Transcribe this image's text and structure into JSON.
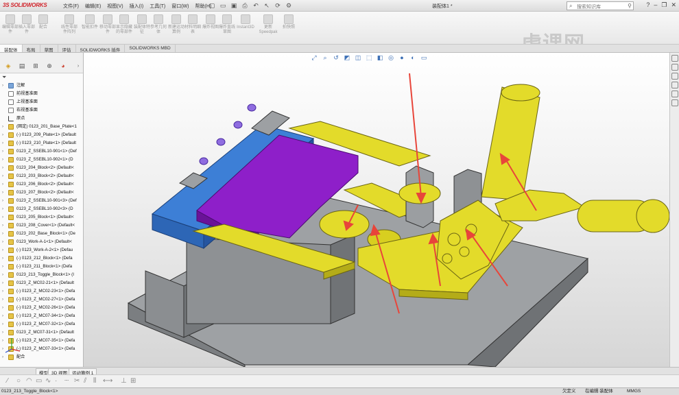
{
  "app": {
    "logo_brand": "SOLIDWORKS",
    "logo_ds": "3S",
    "document_title": "装配体1 *"
  },
  "menu": [
    "文件(F)",
    "编辑(E)",
    "视图(V)",
    "插入(I)",
    "工具(T)",
    "窗口(W)",
    "帮助(H)"
  ],
  "search": {
    "placeholder": "搜索知识库"
  },
  "ribbon": {
    "buttons": [
      "编辑零部件",
      "插入零部件",
      "配合",
      "线性零部件阵列",
      "智能扣件",
      "移动零部件",
      "显示隐藏的零部件",
      "装配体特征",
      "参考几何体",
      "新建运动算例",
      "材料明细表",
      "爆炸视图",
      "爆炸直线草图",
      "Instant3D",
      "更新Speedpak",
      "拍快照"
    ],
    "watermark": "虎课网"
  },
  "command_tabs": [
    "装配体",
    "布局",
    "草图",
    "评估",
    "SOLIDWORKS 插件",
    "SOLIDWORKS MBD"
  ],
  "tree": {
    "items": [
      {
        "label": "注解",
        "icon": "note"
      },
      {
        "label": "前视基准面",
        "icon": "plane"
      },
      {
        "label": "上视基准面",
        "icon": "plane"
      },
      {
        "label": "右视基准面",
        "icon": "plane"
      },
      {
        "label": "原点",
        "icon": "origin"
      },
      {
        "label": "(固定) 0123_201_Base_Plate<1",
        "icon": "part"
      },
      {
        "label": "(-) 0123_209_Plate<1> (Default",
        "icon": "part"
      },
      {
        "label": "(-) 0123_210_Plate<1> (Default",
        "icon": "part"
      },
      {
        "label": "0123_Z_SSEBL10-901<1> (Def",
        "icon": "part"
      },
      {
        "label": "0123_Z_SSEBL10-902<1> (D",
        "icon": "part"
      },
      {
        "label": "0123_204_Block<2> (Default<",
        "icon": "part"
      },
      {
        "label": "0123_203_Block<2> (Default<",
        "icon": "part"
      },
      {
        "label": "0123_206_Block<2> (Default<",
        "icon": "part"
      },
      {
        "label": "0123_207_Block<2> (Default<",
        "icon": "part"
      },
      {
        "label": "0123_Z_SSEBL10-901<3> (Def",
        "icon": "part"
      },
      {
        "label": "0123_Z_SSEBL10-902<3> (D",
        "icon": "part"
      },
      {
        "label": "0123_205_Block<1> (Default<",
        "icon": "part"
      },
      {
        "label": "0123_208_Cover<1> (Default<",
        "icon": "part"
      },
      {
        "label": "0123_202_Base_Block<1> (De",
        "icon": "part"
      },
      {
        "label": "0123_Work-A-1<1> (Default<",
        "icon": "part"
      },
      {
        "label": "(-) 0123_Work-A-2<1> (Defau",
        "icon": "part"
      },
      {
        "label": "(-) 0123_212_Block<1> (Defa",
        "icon": "part"
      },
      {
        "label": "(-) 0123_211_Block<1> (Defa",
        "icon": "part"
      },
      {
        "label": "0123_213_Toggle_Block<1> (I",
        "icon": "part"
      },
      {
        "label": "0123_Z_MC02-21<1> (Default",
        "icon": "part"
      },
      {
        "label": "(-) 0123_Z_MC02-23<1> (Defa",
        "icon": "part"
      },
      {
        "label": "(-) 0123_Z_MC02-27<1> (Defa",
        "icon": "part"
      },
      {
        "label": "(-) 0123_Z_MC02-26<1> (Defa",
        "icon": "part"
      },
      {
        "label": "(-) 0123_Z_MC07-34<1> (Defa",
        "icon": "part"
      },
      {
        "label": "(-) 0123_Z_MC07-32<1> (Defa",
        "icon": "part"
      },
      {
        "label": "0123_Z_MC07-31<1> (Default",
        "icon": "part"
      },
      {
        "label": "(-) 0123_Z_MC07-35<1> (Defa",
        "icon": "part"
      },
      {
        "label": "(-) 0123_Z_MC07-33<1> (Defa",
        "icon": "part"
      },
      {
        "label": "配合",
        "icon": "mate"
      }
    ]
  },
  "bottom_tabs": [
    "模型",
    "3D 视图",
    "运动算例 1"
  ],
  "status": {
    "selected": "0123_213_Toggle_Block<1>",
    "state": "欠定义",
    "mode": "在编辑 装配体",
    "units": "MMGS"
  },
  "colors": {
    "part_yellow": "#e3db2a",
    "part_purple": "#8e1fc9",
    "part_blue": "#3b7fd4",
    "part_gray": "#8f9295",
    "arrow_red": "#e8453a"
  }
}
